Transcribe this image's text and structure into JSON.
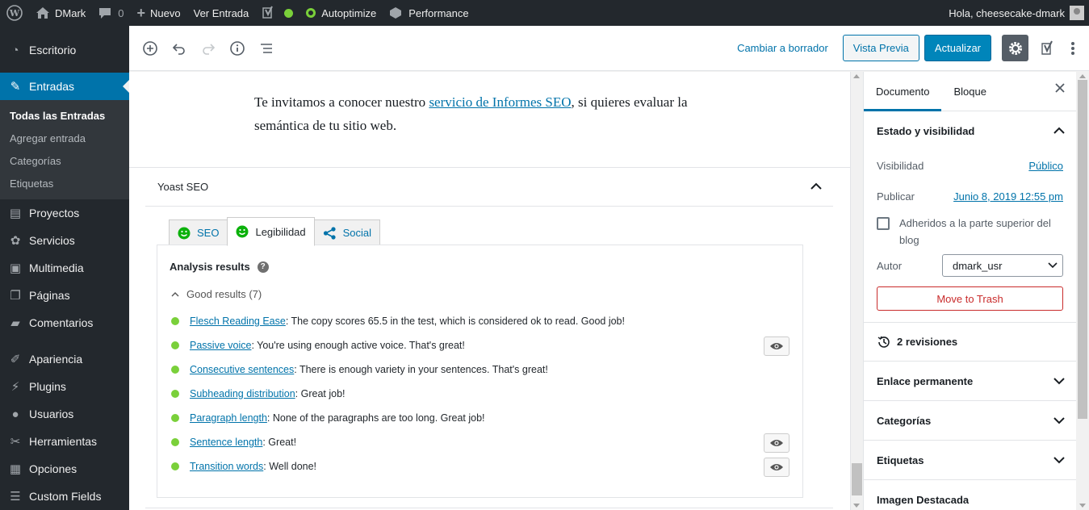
{
  "adminbar": {
    "site_name": "DMark",
    "comments_count": "0",
    "new_label": "Nuevo",
    "view_post": "Ver Entrada",
    "autoptimize": "Autoptimize",
    "performance": "Performance",
    "greeting": "Hola, cheesecake-dmark"
  },
  "sidebar": {
    "items": [
      {
        "label": "Escritorio",
        "icon": "dashboard-icon"
      },
      {
        "label": "Entradas",
        "icon": "pin-icon"
      },
      {
        "label": "Proyectos",
        "icon": "portfolio-icon"
      },
      {
        "label": "Servicios",
        "icon": "services-icon"
      },
      {
        "label": "Multimedia",
        "icon": "media-icon"
      },
      {
        "label": "Páginas",
        "icon": "pages-icon"
      },
      {
        "label": "Comentarios",
        "icon": "comments-icon"
      },
      {
        "label": "Apariencia",
        "icon": "brush-icon"
      },
      {
        "label": "Plugins",
        "icon": "plug-icon"
      },
      {
        "label": "Usuarios",
        "icon": "user-icon"
      },
      {
        "label": "Herramientas",
        "icon": "wrench-icon"
      },
      {
        "label": "Opciones",
        "icon": "settings-icon"
      },
      {
        "label": "Custom Fields",
        "icon": "fields-icon"
      }
    ],
    "sub_items": [
      "Todas las Entradas",
      "Agregar entrada",
      "Categorías",
      "Etiquetas"
    ]
  },
  "toolbar": {
    "draft_label": "Cambiar a borrador",
    "preview_label": "Vista Previa",
    "update_label": "Actualizar"
  },
  "content": {
    "para_before": "Te invitamos a conocer nuestro ",
    "para_link": "servicio de Informes SEO",
    "para_after": ", si quieres evaluar la semántica de tu sitio web."
  },
  "yoast": {
    "title": "Yoast SEO",
    "tabs": [
      "SEO",
      "Legibilidad",
      "Social"
    ],
    "analysis_title": "Analysis results",
    "good_results": "Good results (7)",
    "results": [
      {
        "link": "Flesch Reading Ease",
        "text": ": The copy scores 65.5 in the test, which is considered ok to read. Good job!",
        "eye": false
      },
      {
        "link": "Passive voice",
        "text": ": You're using enough active voice. That's great!",
        "eye": true
      },
      {
        "link": "Consecutive sentences",
        "text": ": There is enough variety in your sentences. That's great!",
        "eye": false
      },
      {
        "link": "Subheading distribution",
        "text": ": Great job!",
        "eye": false
      },
      {
        "link": "Paragraph length",
        "text": ": None of the paragraphs are too long. Great job!",
        "eye": false
      },
      {
        "link": "Sentence length",
        "text": ": Great!",
        "eye": true
      },
      {
        "link": "Transition words",
        "text": ": Well done!",
        "eye": true
      }
    ]
  },
  "settings": {
    "tab_document": "Documento",
    "tab_block": "Bloque",
    "status_title": "Estado y visibilidad",
    "visibility_label": "Visibilidad",
    "visibility_value": "Público",
    "publish_label": "Publicar",
    "publish_value": "Junio 8, 2019 12:55 pm",
    "sticky_label": "Adheridos a la parte superior del blog",
    "author_label": "Autor",
    "author_value": "dmark_usr",
    "trash_label": "Move to Trash",
    "revisions": "2 revisiones",
    "permalink": "Enlace permanente",
    "categories": "Categorías",
    "tags": "Etiquetas",
    "featured_image": "Imagen Destacada"
  },
  "colors": {
    "admin_dark": "#23282d",
    "accent": "#0073aa",
    "good_green": "#7ad03a",
    "trash_red": "#c92c2c"
  }
}
